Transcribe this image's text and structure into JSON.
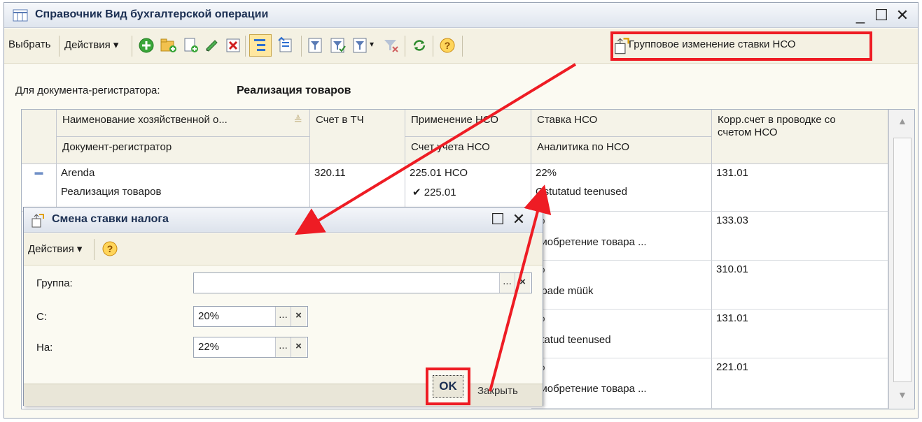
{
  "window": {
    "title": "Справочник Вид бухгалтерской операции",
    "min": "_",
    "max": "☐",
    "close": "✕"
  },
  "toolbar": {
    "select_label": "Выбрать",
    "actions_label": "Действия",
    "arrow": "▾",
    "help_glyph": "?",
    "group_change_label": "Групповое изменение ставки НСО"
  },
  "doc_registrar": {
    "label": "Для документа-регистратора:",
    "value": "Реализация товаров"
  },
  "table": {
    "header_row1": [
      "Наименование хозяйственной о...",
      "Счет в ТЧ",
      "Применение НСО",
      "Ставка НСО",
      "Корр.счет в проводке со"
    ],
    "header_row2": [
      "Документ-регистратор",
      "",
      "Счет учета НСО",
      "Аналитика по НСО",
      "счетом НСО"
    ],
    "sort_marker": "≜",
    "scroll_up": "▲",
    "scroll_down": "▼",
    "row_marker": "▬",
    "rows": [
      {
        "name": "Arenda",
        "doc": "Реализация товаров",
        "acct": "320.11",
        "apply": "225.01 НСО",
        "sub": "✔ 225.01",
        "rate": "22%",
        "analytic": "Ostutatud teenused",
        "corr": "131.01"
      },
      {
        "rate": "%",
        "analytic": "риобретение товара ...",
        "corr": "133.03"
      },
      {
        "rate": "%",
        "analytic": "upade müük",
        "corr": "310.01"
      },
      {
        "rate": "%",
        "analytic": "utatud teenused",
        "corr": "131.01"
      },
      {
        "rate": "%",
        "analytic": "риобретение товара ...",
        "corr": "221.01"
      }
    ]
  },
  "dialog": {
    "title": "Смена ставки налога",
    "actions_label": "Действия",
    "fields": {
      "group_label": "Группа:",
      "group_value": "",
      "from_label": "С:",
      "from_value": "20%",
      "to_label": "На:",
      "to_value": "22%",
      "select_glyph": "...",
      "clear_glyph": "×"
    },
    "ok_label": "OK",
    "close_label": "Закрыть"
  },
  "colors": {
    "highlight_red": "#ee1c24",
    "title_text": "#1b2f52",
    "toolbar_bg": "#f4f1e3"
  }
}
